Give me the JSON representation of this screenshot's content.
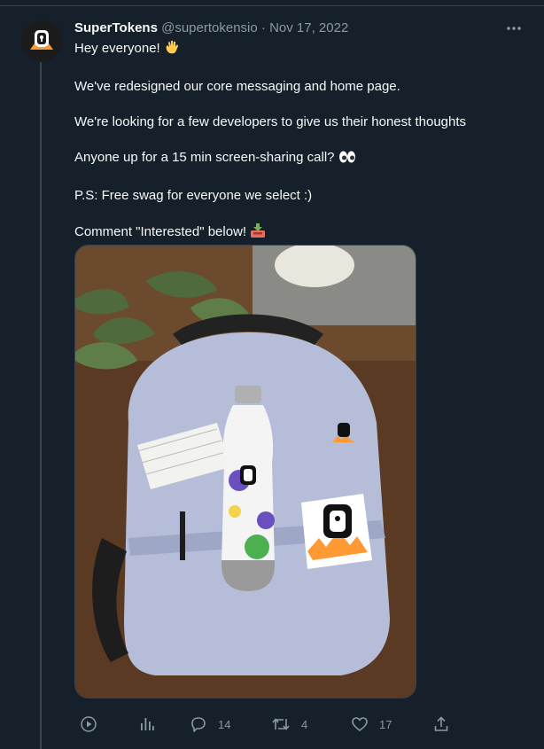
{
  "tweet": {
    "display_name": "SuperTokens",
    "handle": "@supertokensio",
    "separator": "·",
    "date": "Nov 17, 2022",
    "lines": [
      "Hey everyone!",
      "We've redesigned our core messaging and home page.",
      "We're looking for a few developers to give us their honest thoughts",
      "Anyone up for a 15 min screen-sharing call?",
      "P.S: Free swag for everyone we select :)",
      "Comment \"Interested\" below!"
    ],
    "media": {
      "description_icons": [
        "backpack",
        "water-bottle",
        "sticker",
        "notecards"
      ],
      "bottle_brand_text": "SuperTokens"
    }
  },
  "actions": {
    "replies": "14",
    "retweets": "4",
    "likes": "17"
  },
  "icons": {
    "more": "more-dots-icon",
    "view": "play-circle-icon",
    "analytics": "analytics-icon",
    "reply": "reply-icon",
    "retweet": "retweet-icon",
    "like": "heart-icon",
    "share": "share-icon"
  },
  "colors": {
    "background": "#15202b",
    "text": "#f7f9f9",
    "muted": "#8b98a5",
    "border": "#38444d",
    "brand_orange": "#ff9933"
  }
}
